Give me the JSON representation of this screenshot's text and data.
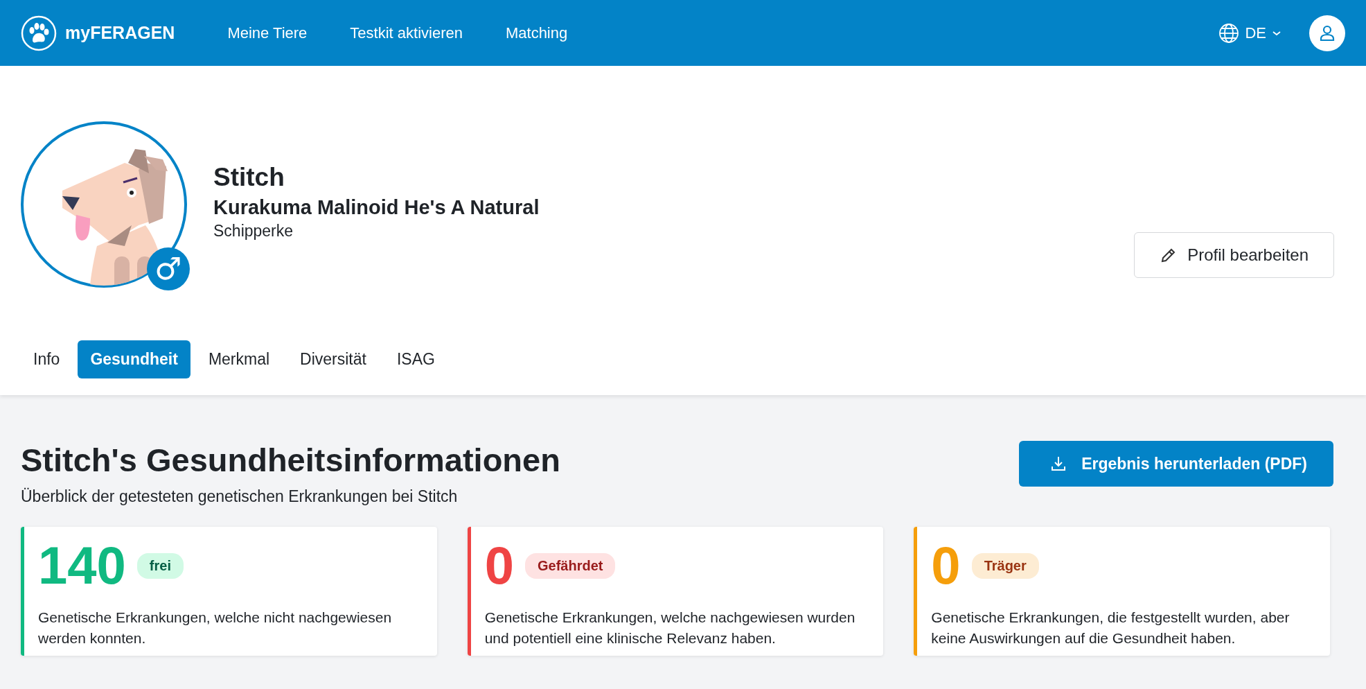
{
  "header": {
    "brand": "myFERAGEN",
    "nav": [
      {
        "label": "Meine Tiere"
      },
      {
        "label": "Testkit aktivieren"
      },
      {
        "label": "Matching"
      }
    ],
    "language": "DE"
  },
  "profile": {
    "name": "Stitch",
    "registered_name": "Kurakuma Malinoid He's A Natural",
    "breed": "Schipperke",
    "sex_symbol": "♂",
    "edit_button": "Profil bearbeiten"
  },
  "tabs": [
    {
      "label": "Info",
      "selected": false
    },
    {
      "label": "Gesundheit",
      "selected": true
    },
    {
      "label": "Merkmal",
      "selected": false
    },
    {
      "label": "Diversität",
      "selected": false
    },
    {
      "label": "ISAG",
      "selected": false
    }
  ],
  "health": {
    "title": "Stitch's Gesundheitsinformationen",
    "subtitle": "Überblick der getesteten genetischen Erkrankungen bei Stitch",
    "download_button": "Ergebnis herunterladen (PDF)",
    "cards": [
      {
        "kind": "free",
        "color": "#10b981",
        "count": "140",
        "badge": "frei",
        "description": "Genetische Erkrankungen, welche nicht nachgewiesen werden konnten."
      },
      {
        "kind": "risk",
        "color": "#ef4444",
        "count": "0",
        "badge": "Gefährdet",
        "description": "Genetische Erkrankungen, welche nachgewiesen wurden und potentiell eine klinische Relevanz haben."
      },
      {
        "kind": "carrier",
        "color": "#f59e0b",
        "count": "0",
        "badge": "Träger",
        "description": "Genetische Erkrankungen, die festgestellt wurden, aber keine Auswirkungen auf die Gesundheit haben."
      }
    ]
  }
}
